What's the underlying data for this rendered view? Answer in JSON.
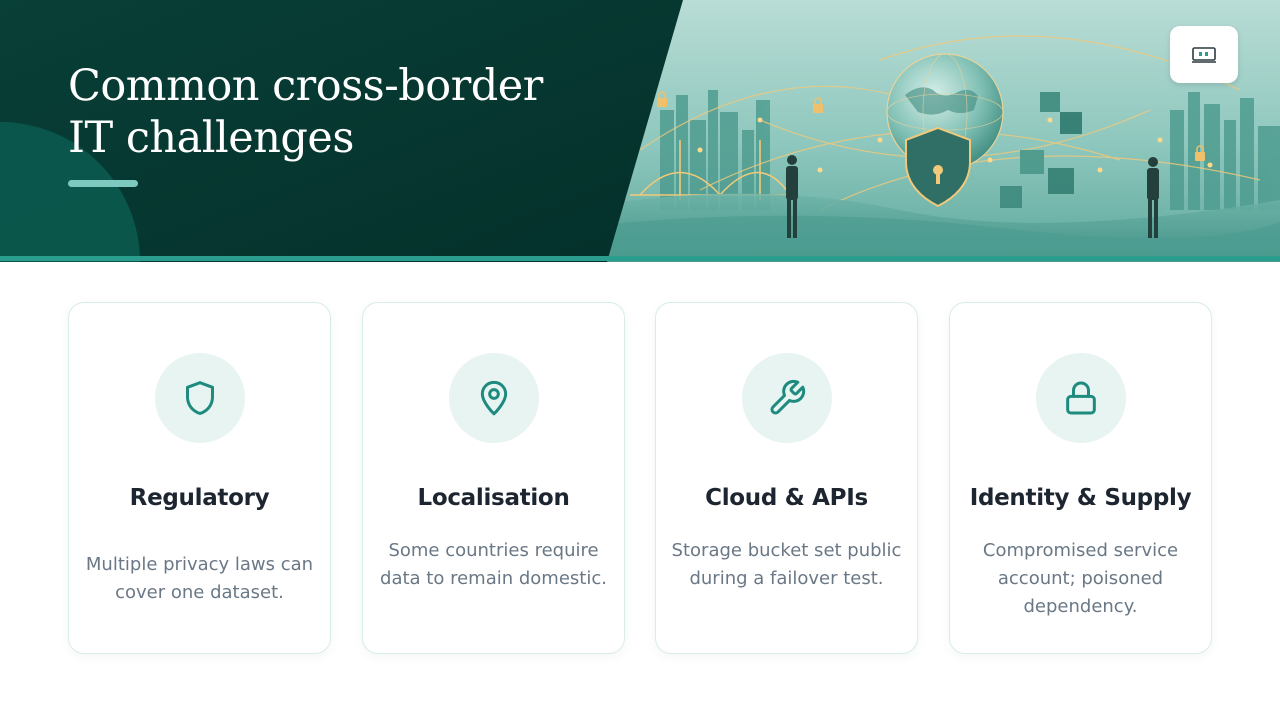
{
  "slide": {
    "title_line1": "Common cross-border",
    "title_line2": "IT challenges"
  },
  "theme": {
    "dark_green": "#063a33",
    "accent_teal": "#2a9d8f",
    "icon_teal": "#1f8a7e",
    "icon_bg": "#e7f4f2"
  },
  "hero_image": {
    "icons": [
      "globe-icon",
      "shield-keyhole-icon",
      "padlock-icon",
      "bridge-icon",
      "skyline-icon",
      "person-icon"
    ]
  },
  "corner_button": {
    "icon": "present-icon"
  },
  "cards": [
    {
      "icon": "shield-icon",
      "title": "Regulatory",
      "desc": "Multiple privacy laws can cover one dataset."
    },
    {
      "icon": "map-pin-icon",
      "title": "Localisation",
      "desc": "Some countries require data to remain domestic."
    },
    {
      "icon": "wrench-icon",
      "title": "Cloud & APIs",
      "desc": "Storage bucket set public during a failover test."
    },
    {
      "icon": "lock-icon",
      "title": "Identity & Supply",
      "desc": "Compromised service account; poisoned dependency."
    }
  ]
}
